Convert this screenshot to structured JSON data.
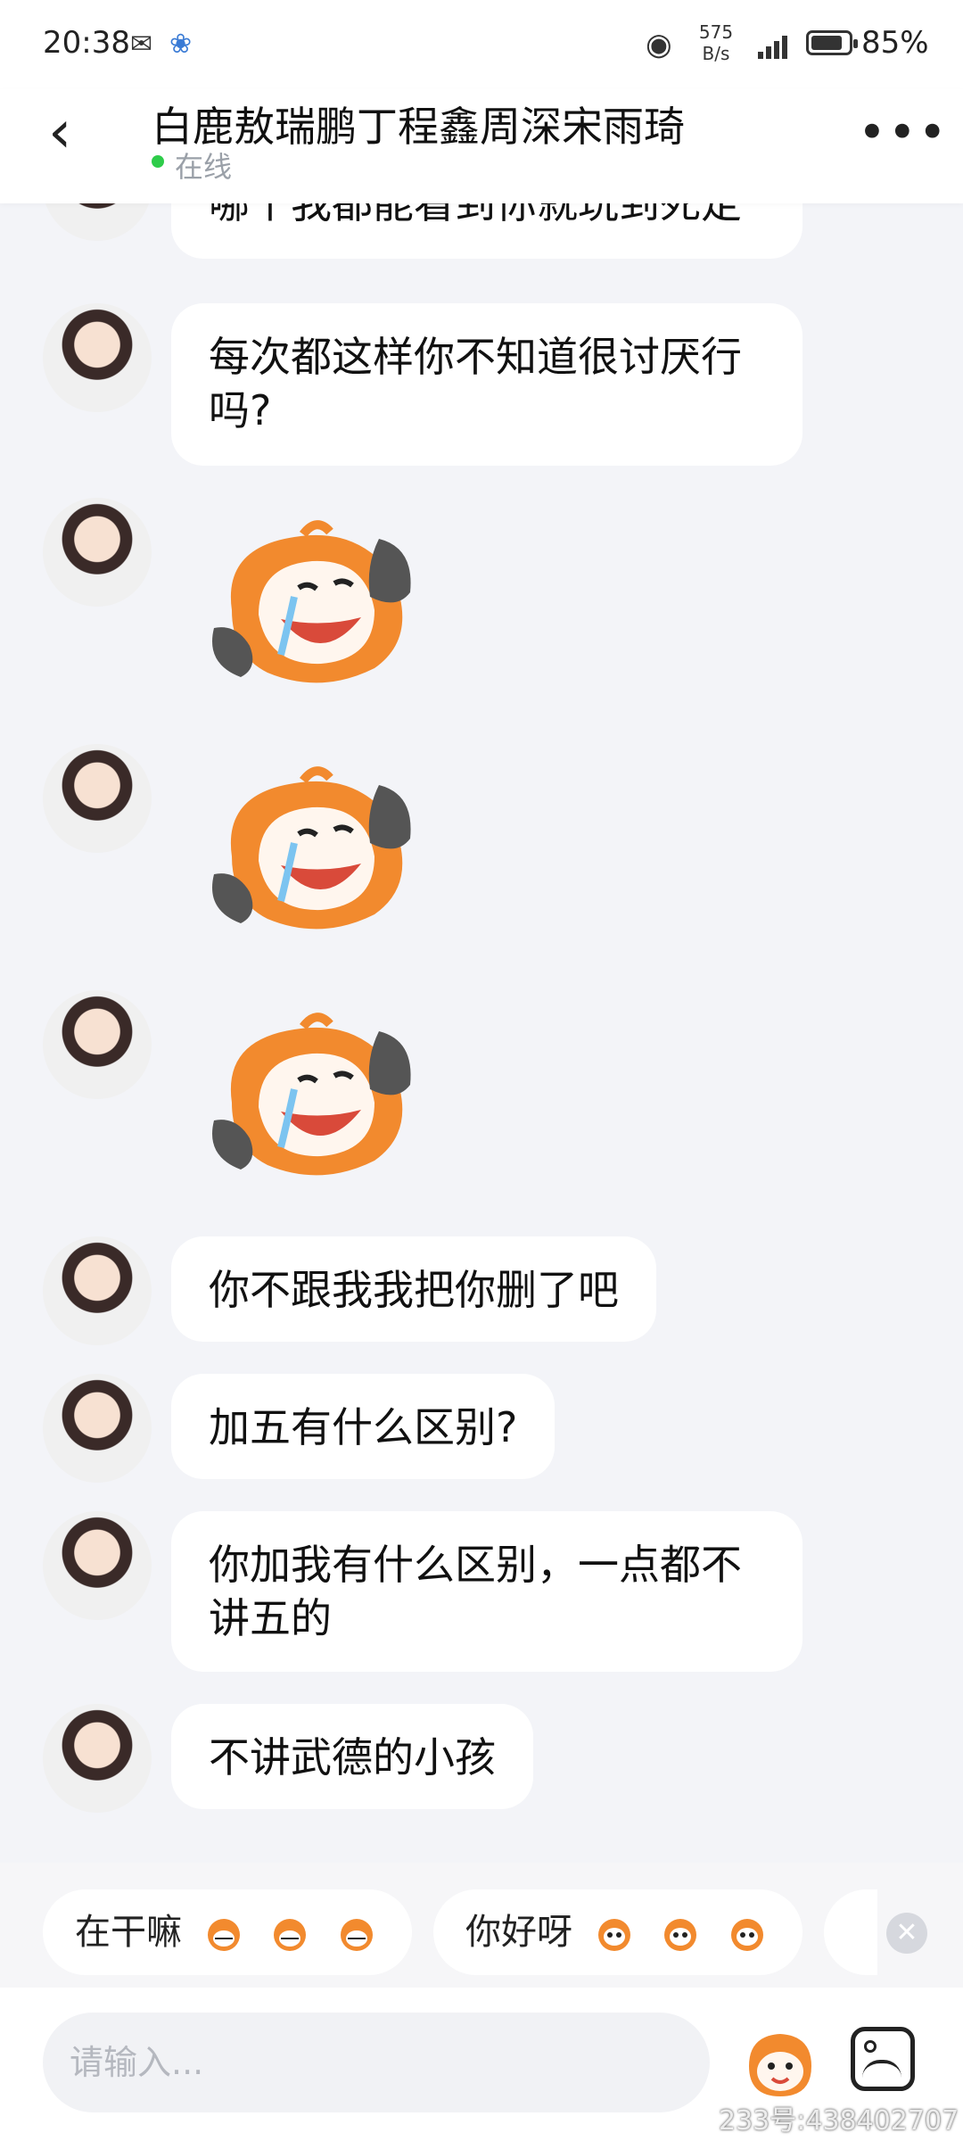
{
  "status_bar": {
    "time": "20:38",
    "net_speed_line1": "575",
    "net_speed_line2": "B/s",
    "battery_percent": "85%",
    "battery_level": 0.85,
    "icons": [
      "wechat-icon",
      "baidu-paw-icon",
      "eye-icon",
      "signal-icon",
      "battery-icon"
    ]
  },
  "header": {
    "back_icon": "chevron-left-icon",
    "title": "白鹿敖瑞鹏丁程鑫周深宋雨琦",
    "status": "在线",
    "status_color": "#2ecc4a",
    "more_icon": "more-dots-icon"
  },
  "messages": [
    {
      "type": "text",
      "text": "哪个我都能看到你就玩到死定"
    },
    {
      "type": "text",
      "text": "每次都这样你不知道很讨厌行吗?"
    },
    {
      "type": "sticker",
      "sticker": "crying-laughing-mascot"
    },
    {
      "type": "sticker",
      "sticker": "crying-laughing-mascot"
    },
    {
      "type": "sticker",
      "sticker": "crying-laughing-mascot"
    },
    {
      "type": "text",
      "text": "你不跟我我把你删了吧"
    },
    {
      "type": "text",
      "text": "加五有什么区别?"
    },
    {
      "type": "text",
      "text": "你加我有什么区别，一点都不讲五的"
    },
    {
      "type": "text",
      "text": "不讲武德的小孩"
    }
  ],
  "quick_replies": [
    {
      "label": "在干嘛",
      "emoji": "grinning-mascot-icon"
    },
    {
      "label": "你好呀",
      "emoji": "mascot-face-icon"
    }
  ],
  "input": {
    "placeholder": "请输入...",
    "mascot_icon": "mascot-emoji-icon",
    "photo_icon": "image-icon"
  },
  "watermark": "233号:438402707",
  "colors": {
    "background": "#f3f4f8",
    "bubble": "#ffffff",
    "mascot_orange": "#f28a2e"
  }
}
